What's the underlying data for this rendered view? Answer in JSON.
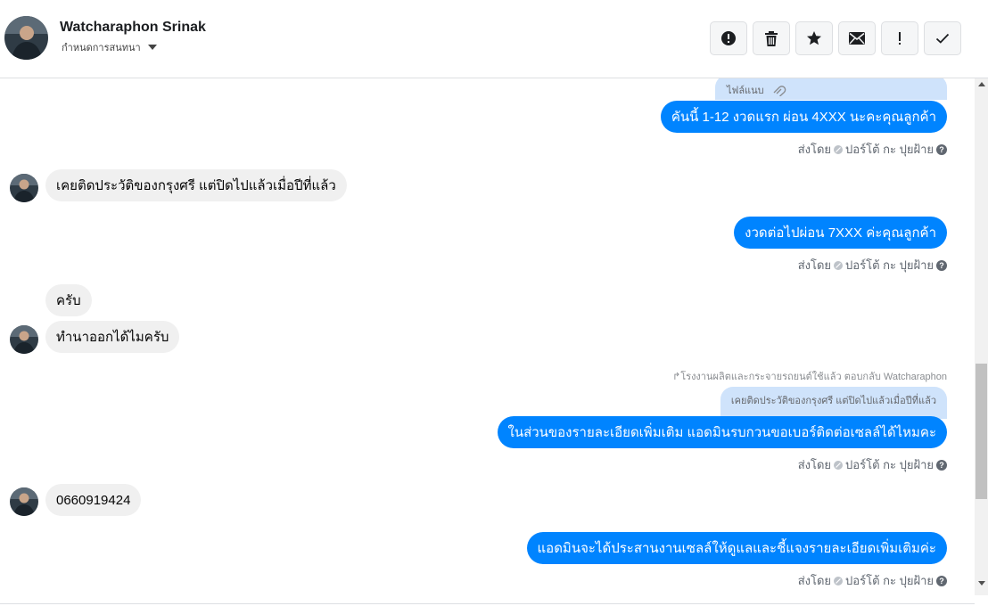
{
  "header": {
    "contact_name": "Watcharaphon Srinak",
    "assign_label": "กำหนดการสนทนา",
    "toolbar": [
      {
        "icon": "alert-circle-icon",
        "name": "mark-spam-button"
      },
      {
        "icon": "trash-icon",
        "name": "delete-button"
      },
      {
        "icon": "star-icon",
        "name": "star-button"
      },
      {
        "icon": "mail-icon",
        "name": "mark-unread-button"
      },
      {
        "icon": "exclamation-icon",
        "name": "follow-up-button"
      },
      {
        "icon": "check-icon",
        "name": "mark-done-button"
      }
    ]
  },
  "thread": {
    "attachment_text": "ไฟล์แนบ",
    "messages": [
      {
        "dir": "out",
        "text": "คันนี้ 1-12 งวดแรก ผ่อน 4XXX นะคะคุณลูกค้า"
      },
      {
        "dir": "in",
        "text": "เคยติดประวัติของกรุงศรี  แต่ปิดไปแล้วเมื่อปีที่แล้ว"
      },
      {
        "dir": "out",
        "text": "งวดต่อไปผ่อน  7XXX ค่ะคุณลูกค้า"
      },
      {
        "dir": "in",
        "text": "ครับ"
      },
      {
        "dir": "in",
        "text": "ทำนาออกได้ไมครับ"
      },
      {
        "dir": "out",
        "text": "ในส่วนของรายละเอียดเพิ่มเติม แอดมินรบกวนขอเบอร์ติดต่อเซลล์ได้ไหมคะ"
      },
      {
        "dir": "in",
        "text": "0660919424"
      },
      {
        "dir": "out",
        "text": "แอดมินจะได้ประสานงานเซลล์ให้ดูแลและชี้แจงรายละเอียดเพิ่มเติมค่ะ"
      }
    ],
    "sent_by_label": "ส่งโดย",
    "sent_by_name": "ปอร์โต้ กะ ปุยฝ้าย",
    "reply_note": "↱โรงงานผลิตและกระจายรถยนต์ใช้แล้ว ตอบกลับ Watcharaphon",
    "quoted_text": "เคยติดประวัติของกรุงศรี แต่ปิดไปแล้วเมื่อปีที่แล้ว"
  },
  "colors": {
    "outgoing_bubble": "#0084ff",
    "incoming_bubble": "#f0f0f0",
    "quoted_bubble": "#cfe3fb"
  }
}
